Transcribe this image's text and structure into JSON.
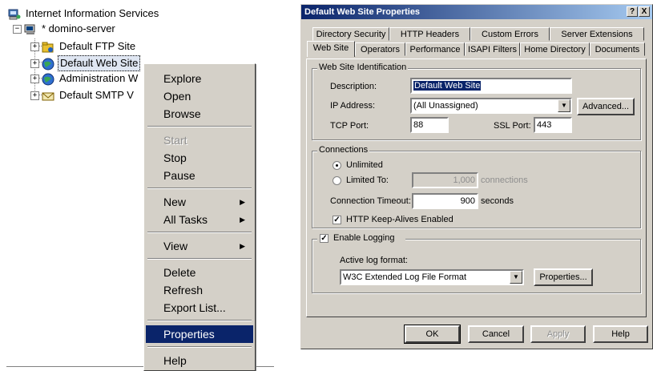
{
  "tree": {
    "root_label": "Internet Information Services",
    "server_label": "* domino-server",
    "items": [
      {
        "label": "Default FTP Site"
      },
      {
        "label": "Default Web Site"
      },
      {
        "label": "Administration W"
      },
      {
        "label": "Default SMTP V"
      }
    ]
  },
  "context_menu": {
    "items": [
      {
        "label": "Explore"
      },
      {
        "label": "Open"
      },
      {
        "label": "Browse"
      },
      {
        "label": "Start"
      },
      {
        "label": "Stop"
      },
      {
        "label": "Pause"
      },
      {
        "label": "New"
      },
      {
        "label": "All Tasks"
      },
      {
        "label": "View"
      },
      {
        "label": "Delete"
      },
      {
        "label": "Refresh"
      },
      {
        "label": "Export List..."
      },
      {
        "label": "Properties"
      },
      {
        "label": "Help"
      }
    ]
  },
  "dialog": {
    "title": "Default Web Site Properties",
    "help_btn": "?",
    "close_btn": "X",
    "tabs_back": [
      "Directory Security",
      "HTTP Headers",
      "Custom Errors",
      "Server Extensions"
    ],
    "tabs_front": [
      "Web Site",
      "Operators",
      "Performance",
      "ISAPI Filters",
      "Home Directory",
      "Documents"
    ],
    "identification": {
      "group_label": "Web Site Identification",
      "description_label": "Description:",
      "description_value": "Default Web Site",
      "ip_label": "IP Address:",
      "ip_value": "(All Unassigned)",
      "advanced_btn": "Advanced...",
      "tcp_label": "TCP Port:",
      "tcp_value": "88",
      "ssl_label": "SSL Port:",
      "ssl_value": "443"
    },
    "connections": {
      "group_label": "Connections",
      "unlimited_label": "Unlimited",
      "limited_label": "Limited To:",
      "limited_value": "1,000",
      "limited_unit": "connections",
      "timeout_label": "Connection Timeout:",
      "timeout_value": "900",
      "timeout_unit": "seconds",
      "keepalive_label": "HTTP Keep-Alives Enabled"
    },
    "logging": {
      "enable_label": "Enable Logging",
      "format_label": "Active log format:",
      "format_value": "W3C Extended Log File Format",
      "properties_btn": "Properties..."
    },
    "buttons": {
      "ok": "OK",
      "cancel": "Cancel",
      "apply": "Apply",
      "help": "Help"
    }
  },
  "colors": {
    "selection": "#0a246a",
    "face": "#d4d0c8"
  }
}
